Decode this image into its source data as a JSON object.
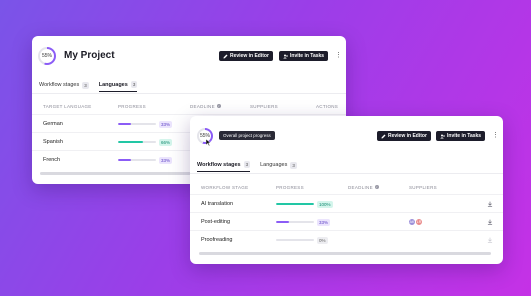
{
  "colors": {
    "bg_start": "#7a54e8",
    "bg_end": "#c531e6",
    "accent_purple": "#8b5cf6",
    "accent_green": "#22c7a5",
    "button_dark": "#1d1d2b"
  },
  "back_card": {
    "progress_ring": {
      "label": "55%",
      "value": 0.55
    },
    "title": "My Project",
    "buttons": {
      "review": "Review in Editor",
      "invite": "Invite in Tasks"
    },
    "tabs": [
      {
        "label": "Workflow stages",
        "count": "3"
      },
      {
        "label": "Languages",
        "count": "3"
      }
    ],
    "columns": {
      "language": "TARGET LANGUAGE",
      "progress": "PROGRESS",
      "deadline": "DEADLINE",
      "suppliers": "SUPPLIERS",
      "actions": "ACTIONS"
    },
    "rows": [
      {
        "name": "German",
        "progress": 0.33,
        "pct": "33%",
        "color": "#8b5cf6"
      },
      {
        "name": "Spanish",
        "progress": 0.66,
        "pct": "66%",
        "color": "#22c7a5"
      },
      {
        "name": "French",
        "progress": 0.33,
        "pct": "33%",
        "color": "#8b5cf6"
      }
    ]
  },
  "front_card": {
    "progress_ring": {
      "label": "55%",
      "value": 0.55
    },
    "tooltip": "Overall project progress",
    "buttons": {
      "review": "Review in Editor",
      "invite": "Invite in Tasks"
    },
    "tabs": [
      {
        "label": "Workflow stages",
        "count": "3"
      },
      {
        "label": "Languages",
        "count": "3"
      }
    ],
    "columns": {
      "stage": "WORKFLOW STAGE",
      "progress": "PROGRESS",
      "deadline": "DEADLINE",
      "suppliers": "SUPPLIERS"
    },
    "rows": [
      {
        "name": "AI translation",
        "progress": 1.0,
        "pct": "100%",
        "color": "#22c7a5"
      },
      {
        "name": "Post-editing",
        "progress": 0.33,
        "pct": "33%",
        "color": "#8b5cf6"
      },
      {
        "name": "Proofreading",
        "progress": 0.0,
        "pct": "0%",
        "color": "#c9c9d2"
      }
    ],
    "suppliers_avatars": [
      {
        "initials": "AK",
        "color": "#9b8fd9"
      },
      {
        "initials": "LR",
        "color": "#e98a8a"
      }
    ]
  }
}
